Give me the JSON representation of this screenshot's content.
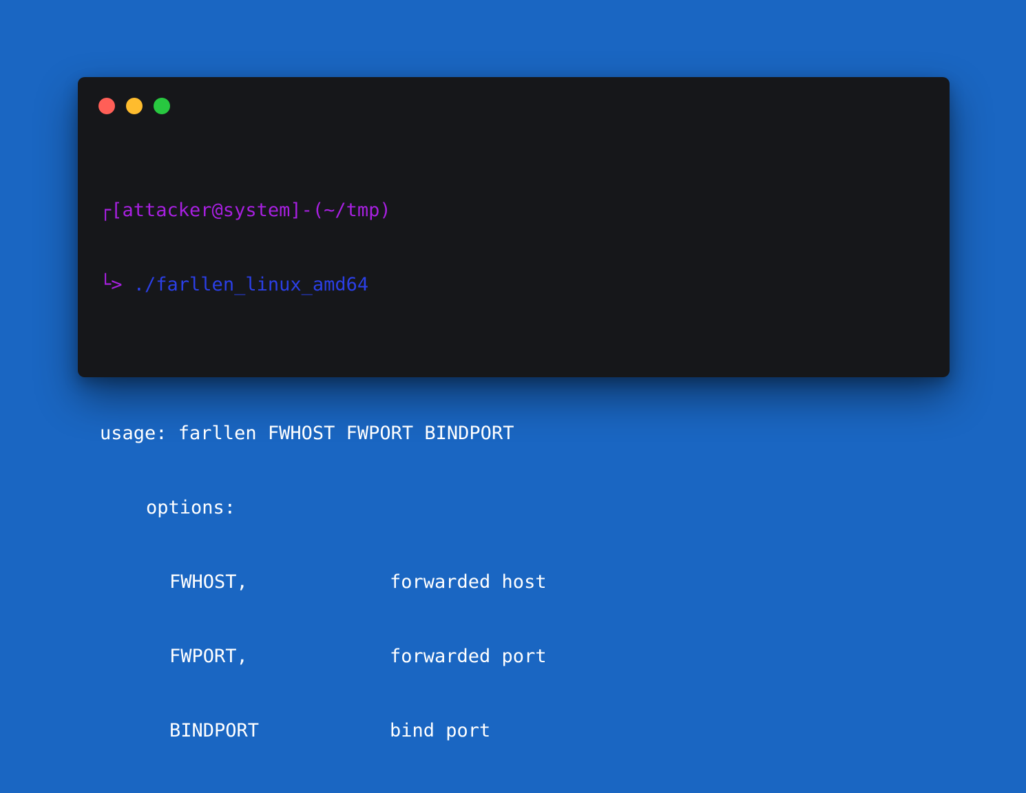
{
  "terminal": {
    "controls": [
      {
        "name": "close",
        "color": "#ff5f57"
      },
      {
        "name": "minimize",
        "color": "#febc2e"
      },
      {
        "name": "maximize",
        "color": "#28c840"
      }
    ],
    "prompt": {
      "line1": "┌[attacker@system]-(~/tmp)",
      "line2_arrow": "└>",
      "command": " ./farllen_linux_amd64"
    },
    "output": {
      "usage": "usage: farllen FWHOST FWPORT BINDPORT",
      "options_header": "options:",
      "options": [
        {
          "name": "FWHOST,",
          "desc": "forwarded host"
        },
        {
          "name": "FWPORT,",
          "desc": "forwarded port"
        },
        {
          "name": "BINDPORT",
          "desc": "bind port"
        }
      ]
    }
  },
  "colors": {
    "background": "#1a66c2",
    "terminal_bg": "#16171a",
    "prompt": "#a720e0",
    "command": "#2b3fe6",
    "text": "#ffffff"
  }
}
